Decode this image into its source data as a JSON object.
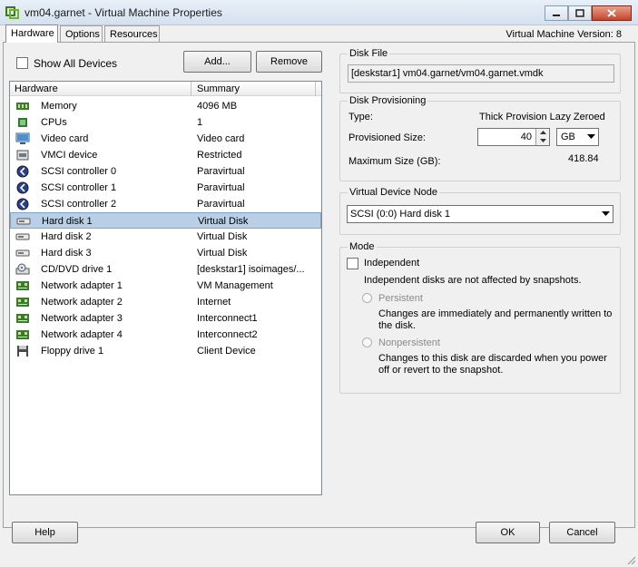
{
  "window": {
    "title": "vm04.garnet - Virtual Machine Properties",
    "version": "Virtual Machine Version: 8"
  },
  "tabs": [
    "Hardware",
    "Options",
    "Resources"
  ],
  "hardware": {
    "show_all_devices": "Show All Devices",
    "add_label": "Add...",
    "remove_label": "Remove",
    "col_hardware": "Hardware",
    "col_summary": "Summary",
    "devices": [
      {
        "name": "Memory",
        "summary": "4096 MB",
        "icon": "memory-icon"
      },
      {
        "name": "CPUs",
        "summary": "1",
        "icon": "cpu-icon"
      },
      {
        "name": "Video card",
        "summary": "Video card",
        "icon": "monitor-icon"
      },
      {
        "name": "VMCI device",
        "summary": "Restricted",
        "icon": "device-icon"
      },
      {
        "name": "SCSI controller 0",
        "summary": "Paravirtual",
        "icon": "scsi-icon"
      },
      {
        "name": "SCSI controller 1",
        "summary": "Paravirtual",
        "icon": "scsi-icon"
      },
      {
        "name": "SCSI controller 2",
        "summary": "Paravirtual",
        "icon": "scsi-icon"
      },
      {
        "name": "Hard disk 1",
        "summary": "Virtual Disk",
        "icon": "disk-icon"
      },
      {
        "name": "Hard disk 2",
        "summary": "Virtual Disk",
        "icon": "disk-icon"
      },
      {
        "name": "Hard disk 3",
        "summary": "Virtual Disk",
        "icon": "disk-icon"
      },
      {
        "name": "CD/DVD drive 1",
        "summary": "[deskstar1] isoimages/...",
        "icon": "cdrom-icon"
      },
      {
        "name": "Network adapter 1",
        "summary": "VM Management",
        "icon": "network-icon"
      },
      {
        "name": "Network adapter 2",
        "summary": "Internet",
        "icon": "network-icon"
      },
      {
        "name": "Network adapter 3",
        "summary": "Interconnect1",
        "icon": "network-icon"
      },
      {
        "name": "Network adapter 4",
        "summary": "Interconnect2",
        "icon": "network-icon"
      },
      {
        "name": "Floppy drive 1",
        "summary": "Client Device",
        "icon": "floppy-icon"
      }
    ]
  },
  "disk_file": {
    "label": "Disk File",
    "value": "[deskstar1] vm04.garnet/vm04.garnet.vmdk"
  },
  "provisioning": {
    "label": "Disk Provisioning",
    "type_label": "Type:",
    "type_value": "Thick Provision Lazy Zeroed",
    "size_label": "Provisioned Size:",
    "size_value": "40",
    "unit": "GB",
    "max_label": "Maximum Size (GB):",
    "max_value": "418.84"
  },
  "vdn": {
    "label": "Virtual Device Node",
    "value": "SCSI (0:0) Hard disk 1"
  },
  "mode": {
    "label": "Mode",
    "independent": "Independent",
    "independent_desc": "Independent disks are not affected by snapshots.",
    "persistent": "Persistent",
    "persistent_desc_1": "Changes are immediately and permanently written to",
    "persistent_desc_2": "the disk.",
    "nonpersistent": "Nonpersistent",
    "nonpersistent_desc_1": "Changes to this disk are discarded when you power",
    "nonpersistent_desc_2": "off or revert to the snapshot."
  },
  "footer": {
    "help": "Help",
    "ok": "OK",
    "cancel": "Cancel"
  },
  "colors": {
    "selection": "#b8cfe6",
    "titlebar": "#d4e1ee",
    "close": "#c7452c"
  }
}
